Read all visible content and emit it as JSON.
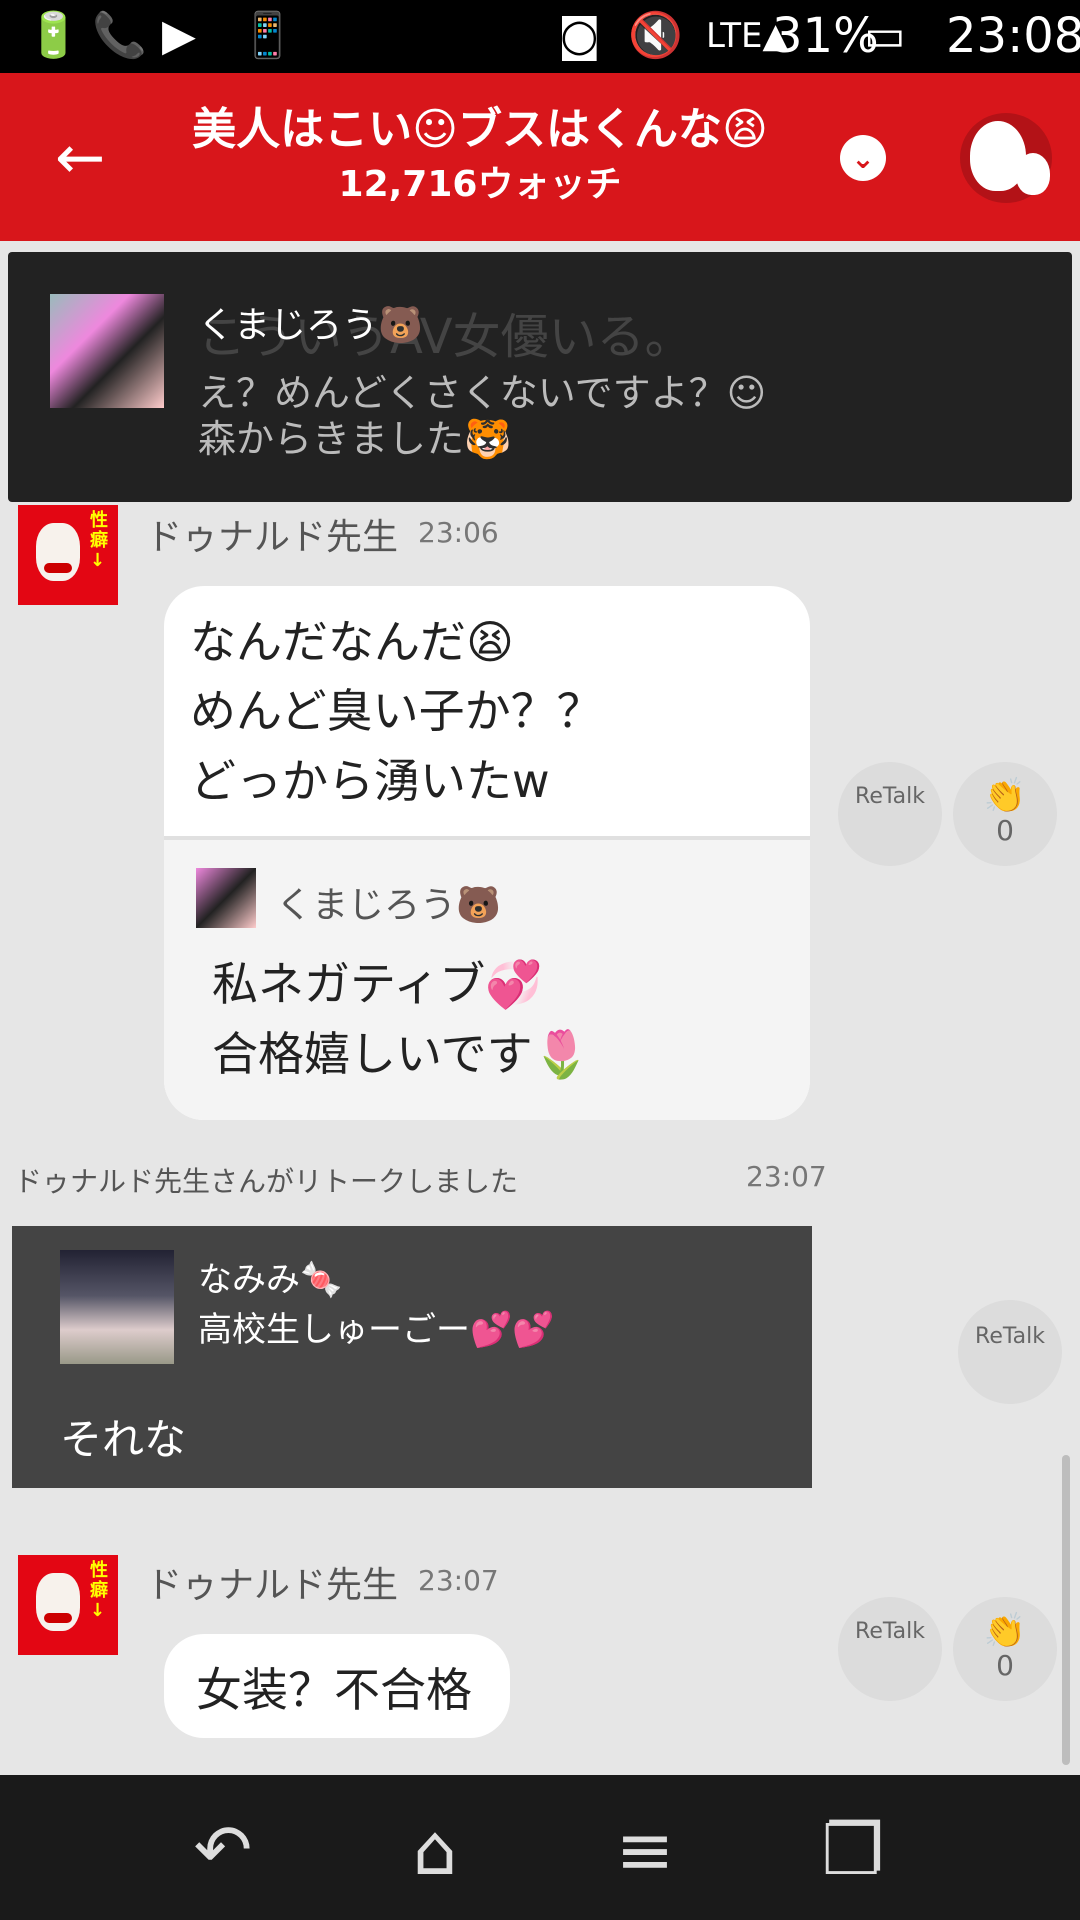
{
  "status_bar": {
    "battery_percent": "31%",
    "time": "23:08",
    "icons": [
      "battery-charging-icon",
      "phone-icon",
      "play-icon",
      "screen-rotate-icon",
      "vr-icon",
      "mute-icon",
      "lte-signal-icon",
      "battery-icon"
    ]
  },
  "header": {
    "title": "美人はこい☺ブスはくんな😫",
    "watch_count": "12,716ウォッチ",
    "back_icon": "arrow-left-icon",
    "dropdown_icon": "chevron-down-icon",
    "mascot_icon": "ghost-mascot-icon",
    "colors": {
      "bar": "#d8161b"
    }
  },
  "overlay": {
    "name": "くまじろう🐻",
    "line1": "え？めんどくさくないですよ？☺",
    "line2": "森からきました🐯",
    "behind_text": "こういうAV女優いる。"
  },
  "message1": {
    "sender": "ドゥナルド先生",
    "time": "23:06",
    "lines": [
      "なんだなんだ😫",
      "めんど臭い子か？？",
      "どっから湧いたw"
    ],
    "quoted": {
      "name": "くまじろう🐻",
      "lines": [
        "私ネガティブ💞",
        "合格嬉しいです🌷"
      ]
    },
    "retalk_label": "ReTalk",
    "clap_count": "0"
  },
  "retalk_notice": {
    "text": "ドゥナルド先生さんがリトークしました",
    "time": "23:07"
  },
  "retalk_card": {
    "name": "なみみ🍬",
    "status": "高校生しゅーごー💕💕",
    "message": "それな",
    "retalk_label": "ReTalk"
  },
  "message2": {
    "sender": "ドゥナルド先生",
    "time": "23:07",
    "text": "女装？不合格",
    "retalk_label": "ReTalk",
    "clap_count": "0"
  },
  "nav": {
    "icons": [
      "back-icon",
      "home-icon",
      "menu-icon",
      "recent-apps-icon"
    ]
  }
}
